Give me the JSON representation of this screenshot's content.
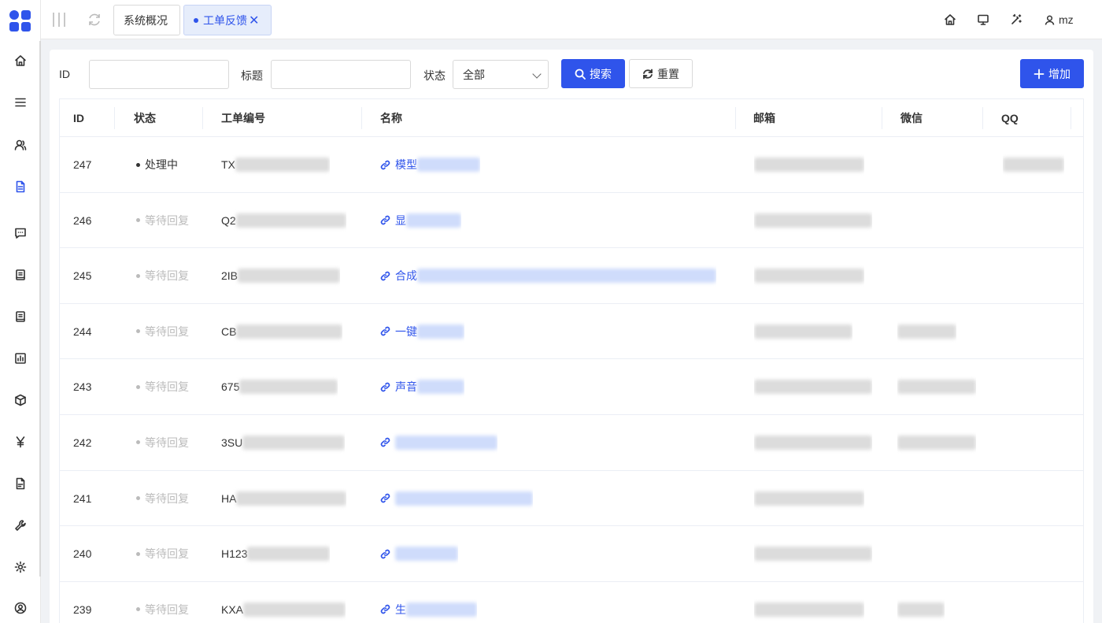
{
  "tabs": [
    {
      "label": "系统概况"
    },
    {
      "label": "工单反馈",
      "close": "✕"
    }
  ],
  "user": {
    "name": "mz"
  },
  "filters": {
    "id_label": "ID",
    "title_label": "标题",
    "status_label": "状态",
    "status_value": "全部",
    "search_label": "搜索",
    "reset_label": "重置",
    "add_label": "增加"
  },
  "table": {
    "headers": [
      "ID",
      "状态",
      "工单编号",
      "名称",
      "邮箱",
      "微信",
      "QQ"
    ],
    "rows": [
      {
        "id": "247",
        "status": "处理中",
        "order_no": "TX",
        "name": "模型"
      },
      {
        "id": "246",
        "status": "等待回复",
        "order_no": "Q2",
        "name": "显"
      },
      {
        "id": "245",
        "status": "等待回复",
        "order_no": "2IB",
        "name": "合成"
      },
      {
        "id": "244",
        "status": "等待回复",
        "order_no": "CB",
        "name": "一键"
      },
      {
        "id": "243",
        "status": "等待回复",
        "order_no": "675",
        "name": "声音"
      },
      {
        "id": "242",
        "status": "等待回复",
        "order_no": "3SU",
        "name": ""
      },
      {
        "id": "241",
        "status": "等待回复",
        "order_no": "HA",
        "name": ""
      },
      {
        "id": "240",
        "status": "等待回复",
        "order_no": "H123",
        "name": ""
      },
      {
        "id": "239",
        "status": "等待回复",
        "order_no": "KXA",
        "name": "生"
      }
    ]
  },
  "colors": {
    "accent": "#2f54eb",
    "tab_active_bg": "#e6edfb"
  },
  "icons": {
    "sidebar": [
      "home-icon",
      "menu-icon",
      "users-icon",
      "document-icon",
      "message-icon",
      "book-icon",
      "book-icon",
      "chart-icon",
      "cube-icon",
      "yen-icon",
      "file-icon",
      "wrench-icon",
      "settings-icon",
      "account-icon"
    ],
    "topbar": [
      "home-icon",
      "monitor-icon",
      "magic-wand-icon",
      "user-icon"
    ]
  }
}
